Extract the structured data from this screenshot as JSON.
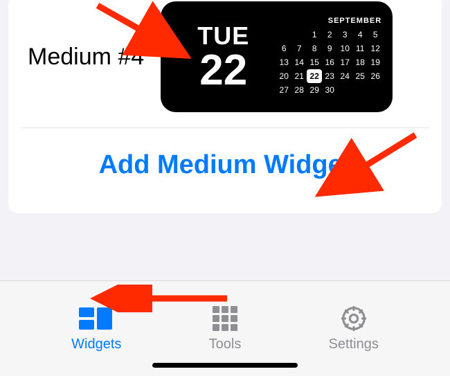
{
  "widget": {
    "label": "Medium #4",
    "preview": {
      "day_abbrev": "TUE",
      "date": "22",
      "month": "SEPTEMBER",
      "calendar": {
        "leading_blanks": 2,
        "days_in_month": 30,
        "today": 22
      }
    }
  },
  "add_button_label": "Add Medium Widget",
  "tabbar": {
    "items": [
      {
        "label": "Widgets",
        "icon": "widgets",
        "active": true
      },
      {
        "label": "Tools",
        "icon": "grid",
        "active": false
      },
      {
        "label": "Settings",
        "icon": "gear",
        "active": false
      }
    ]
  },
  "colors": {
    "accent": "#007aff",
    "secondary": "#8e8e93"
  }
}
